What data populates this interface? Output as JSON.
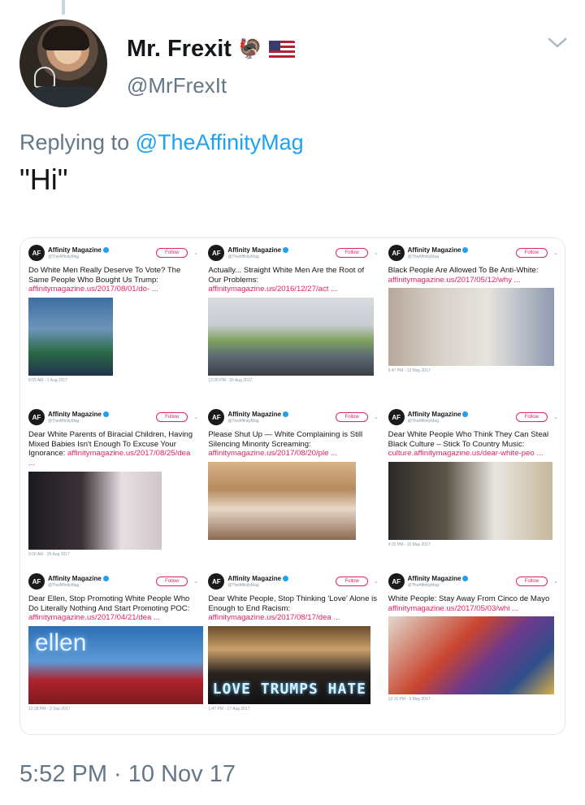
{
  "user": {
    "display_name": "Mr. Frexit",
    "name_emoji": "🦃",
    "handle": "@MrFrexIt"
  },
  "reply": {
    "prefix": "Replying to",
    "target": "@TheAffinityMag"
  },
  "tweet": {
    "text": "\"Hi\"",
    "timestamp": "5:52 PM · 10 Nov 17"
  },
  "embedded_cards": [
    {
      "account": "Affinity Magazine",
      "handle": "@TheAffinityMag",
      "follow": "Follow",
      "text": "Do White Men Really Deserve To Vote? The Same People Who Bought Us Trump:",
      "link": "affinitymagazine.us/2017/08/01/do- ...",
      "time": "8:55 AM - 1 Aug 2017"
    },
    {
      "account": "Affinity Magazine",
      "handle": "@TheAffinityMag",
      "follow": "Follow",
      "text": "Actually... Straight White Men Are the Root of Our Problems:",
      "link": "affinitymagazine.us/2016/12/27/act ...",
      "time": "12:20 PM - 30 Aug 2017"
    },
    {
      "account": "Affinity Magazine",
      "handle": "@TheAffinityMag",
      "follow": "Follow",
      "text": "Black People Are Allowed To Be Anti-White:",
      "link": "affinitymagazine.us/2017/05/12/why ...",
      "time": "6:47 PM - 12 May 2017"
    },
    {
      "account": "Affinity Magazine",
      "handle": "@TheAffinityMag",
      "follow": "Follow",
      "text": "Dear White Parents of Biracial Children, Having Mixed Babies Isn't Enough To Excuse Your Ignorance:",
      "link": "affinitymagazine.us/2017/08/25/dea ...",
      "time": "9:00 AM - 26 Aug 2017"
    },
    {
      "account": "Affinity Magazine",
      "handle": "@TheAffinityMag",
      "follow": "Follow",
      "text": "Please Shut Up — White Complaining is Still Silencing Minority Screaming:",
      "link": "affinitymagazine.us/2017/08/20/ple ...",
      "time": ""
    },
    {
      "account": "Affinity Magazine",
      "handle": "@TheAffinityMag",
      "follow": "Follow",
      "text": "Dear White People Who Think They Can Steal Black Culture – Stick To Country Music:",
      "link": "culture.affinitymagazine.us/dear-white-peo ...",
      "time": "4:25 PM - 15 May 2017"
    },
    {
      "account": "Affinity Magazine",
      "handle": "@TheAffinityMag",
      "follow": "Follow",
      "text": "Dear Ellen, Stop Promoting White People Who Do Literally Nothing And Start Promoting POC:",
      "link": "affinitymagazine.us/2017/04/21/dea ...",
      "time": "12:38 PM - 3 Sep 2017",
      "photo_text": "ellen"
    },
    {
      "account": "Affinity Magazine",
      "handle": "@TheAffinityMag",
      "follow": "Follow",
      "text": "Dear White People, Stop Thinking 'Love' Alone is Enough to End Racism:",
      "link": "affinitymagazine.us/2017/08/17/dea ...",
      "time": "1:47 PM - 17 Aug 2017",
      "photo_text": "LOVE TRUMPS HATE"
    },
    {
      "account": "Affinity Magazine",
      "handle": "@TheAffinityMag",
      "follow": "Follow",
      "text": "White People: Stay Away From Cinco de Mayo",
      "link": "affinitymagazine.us/2017/05/03/whi ...",
      "time": "12:15 PM - 5 May 2017"
    }
  ],
  "colors": {
    "link_blue": "#1da1f2",
    "follow_pink": "#e0245e",
    "secondary_text": "#657786"
  },
  "icons": {
    "caret": "chevron-down-icon",
    "flag": "us-flag-icon",
    "verified": "verified-badge-icon"
  }
}
